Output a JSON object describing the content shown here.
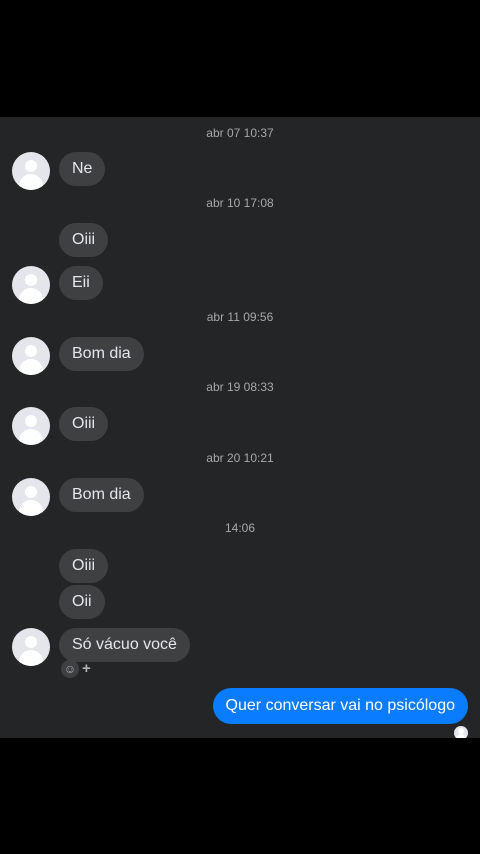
{
  "conversation": {
    "timestamps": [
      "abr 07 10:37",
      "abr 10 17:08",
      "abr 11 09:56",
      "abr 19 08:33",
      "abr 20 10:21",
      "14:06"
    ],
    "incoming": [
      "Ne",
      "Oiii",
      "Eii",
      "Bom dia",
      "Oiii",
      "Bom dia",
      "Oiii",
      "Oii",
      "Só vácuo você"
    ],
    "outgoing": [
      "Quer conversar vai no psicólogo"
    ],
    "reaction_icon": "smiley-icon",
    "reaction_plus": "+"
  },
  "colors": {
    "background": "#242526",
    "incoming_bubble": "#3e4042",
    "outgoing_bubble": "#0a7cff",
    "timestamp_text": "#a8a8a8"
  }
}
